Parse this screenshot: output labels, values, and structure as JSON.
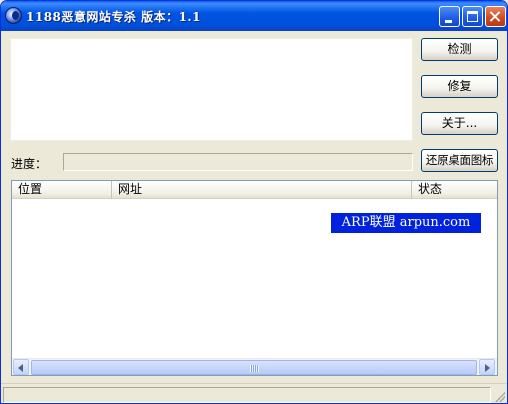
{
  "window": {
    "title": "1188恶意网站专杀  版本：1.1"
  },
  "titlebar_buttons": {
    "minimize_icon": "minimize-icon",
    "maximize_icon": "maximize-icon",
    "close_icon": "close-icon"
  },
  "buttons": {
    "detect": "检测",
    "repair": "修复",
    "about": "关于...",
    "restore_desktop_icons": "还原桌面图标"
  },
  "progress": {
    "label": "进度：",
    "value": 0
  },
  "list": {
    "columns": [
      "位置",
      "网址",
      "状态"
    ],
    "rows": []
  },
  "watermark": {
    "text": "ARP联盟 arpun.com"
  },
  "colors": {
    "titlebar": "#0054E3",
    "window_bg": "#ECE9D8",
    "watermark_bg": "#0022DD",
    "close_button": "#D2481E"
  }
}
